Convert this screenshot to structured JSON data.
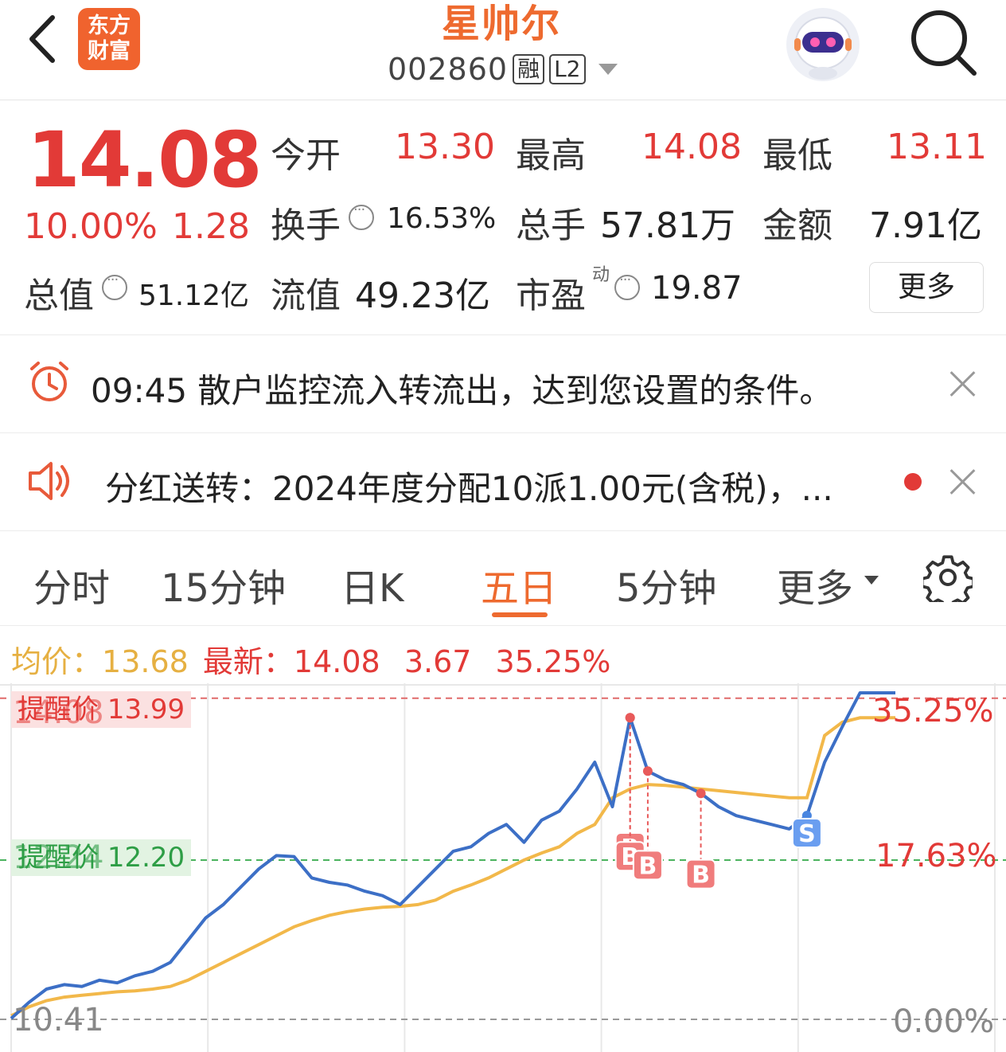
{
  "header": {
    "logo_line1": "东方",
    "logo_line2": "财富",
    "stock_name": "星帅尔",
    "stock_code": "002860",
    "tag_margin": "融",
    "tag_level": "L2"
  },
  "quote": {
    "price": "14.08",
    "change_pct": "10.00%",
    "change_amt": "1.28",
    "open_label": "今开",
    "open_value": "13.30",
    "high_label": "最高",
    "high_value": "14.08",
    "low_label": "最低",
    "low_value": "13.11",
    "turnover_label": "换手",
    "turnover_value": "16.53%",
    "volume_label": "总手",
    "volume_value": "57.81万",
    "amount_label": "金额",
    "amount_value": "7.91亿",
    "mcap_label": "总值",
    "mcap_value": "51.12亿",
    "float_label": "流值",
    "float_value": "49.23亿",
    "pe_label": "市盈",
    "pe_sup": "动",
    "pe_value": "19.87",
    "more_button": "更多"
  },
  "notices": [
    {
      "text": "09:45 散户监控流入转流出，达到您设置的条件。"
    },
    {
      "text": "分红送转：2024年度分配10派1.00元(含税)，..."
    }
  ],
  "tabs": {
    "items": [
      "分时",
      "15分钟",
      "日K",
      "五日",
      "5分钟",
      "更多"
    ],
    "active": "五日"
  },
  "legend": {
    "avg_label": "均价：",
    "avg_value": "13.68",
    "new_label": "最新：",
    "new_value": "14.08",
    "change_amt": "3.67",
    "change_pct": "35.25%"
  },
  "chart_data": {
    "type": "line",
    "days": 5,
    "y_axis_left": {
      "top": "14.08",
      "mid": "12.24",
      "bottom": "10.41"
    },
    "y_axis_right": {
      "top": "35.25%",
      "mid": "17.63%",
      "bottom": "0.00%"
    },
    "alerts": [
      {
        "label": "提醒价",
        "value": "13.99",
        "color": "#e23a37"
      },
      {
        "label": "提醒价",
        "value": "12.20",
        "color": "#2e9e46"
      }
    ],
    "price_series": [
      10.42,
      10.6,
      10.75,
      10.8,
      10.78,
      10.85,
      10.82,
      10.9,
      10.95,
      11.05,
      11.3,
      11.55,
      11.7,
      11.9,
      12.1,
      12.25,
      12.24,
      12.0,
      11.95,
      11.92,
      11.85,
      11.8,
      11.7,
      11.9,
      12.1,
      12.3,
      12.35,
      12.5,
      12.6,
      12.4,
      12.65,
      12.75,
      13.0,
      13.3,
      12.8,
      13.8,
      13.2,
      13.1,
      13.05,
      12.95,
      12.8,
      12.7,
      12.65,
      12.6,
      12.55,
      12.7,
      13.3,
      13.7,
      14.08,
      14.08,
      14.08
    ],
    "avg_series": [
      10.45,
      10.55,
      10.62,
      10.66,
      10.68,
      10.7,
      10.72,
      10.73,
      10.75,
      10.78,
      10.85,
      10.95,
      11.05,
      11.15,
      11.25,
      11.35,
      11.45,
      11.52,
      11.58,
      11.62,
      11.65,
      11.67,
      11.68,
      11.7,
      11.75,
      11.85,
      11.92,
      12.0,
      12.1,
      12.2,
      12.28,
      12.35,
      12.5,
      12.6,
      12.9,
      13.0,
      13.05,
      13.04,
      13.02,
      13.0,
      12.98,
      12.96,
      12.94,
      12.92,
      12.9,
      12.9,
      13.6,
      13.75,
      13.8,
      13.8,
      13.8
    ],
    "markers": [
      {
        "type": "B",
        "label": "B"
      },
      {
        "type": "B",
        "label": "B"
      },
      {
        "type": "B",
        "label": "B"
      },
      {
        "type": "B",
        "label": "B"
      },
      {
        "type": "S",
        "label": "S"
      }
    ]
  }
}
